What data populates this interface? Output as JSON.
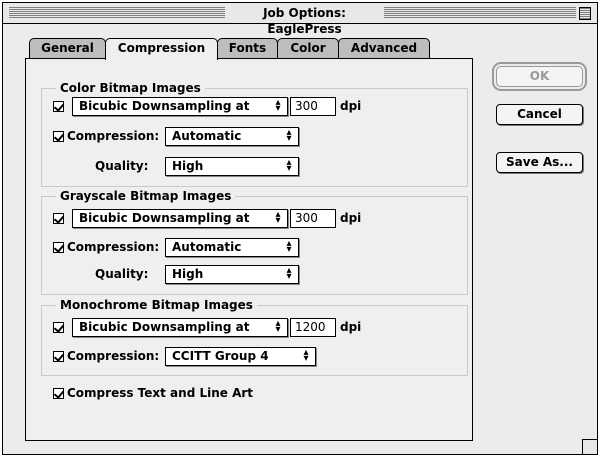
{
  "window": {
    "title": "Job Options: EaglePress"
  },
  "tabs": [
    {
      "label": "General",
      "active": false
    },
    {
      "label": "Compression",
      "active": true
    },
    {
      "label": "Fonts",
      "active": false
    },
    {
      "label": "Color",
      "active": false
    },
    {
      "label": "Advanced",
      "active": false
    }
  ],
  "color_bitmap": {
    "title": "Color Bitmap Images",
    "downsampling_checked": true,
    "downsampling_method": "Bicubic Downsampling at",
    "resolution": "300",
    "unit": "dpi",
    "compression_checked": true,
    "compression_label": "Compression:",
    "compression_value": "Automatic",
    "quality_label": "Quality:",
    "quality_value": "High"
  },
  "grayscale_bitmap": {
    "title": "Grayscale Bitmap Images",
    "downsampling_checked": true,
    "downsampling_method": "Bicubic Downsampling at",
    "resolution": "300",
    "unit": "dpi",
    "compression_checked": true,
    "compression_label": "Compression:",
    "compression_value": "Automatic",
    "quality_label": "Quality:",
    "quality_value": "High"
  },
  "monochrome_bitmap": {
    "title": "Monochrome Bitmap Images",
    "downsampling_checked": true,
    "downsampling_method": "Bicubic Downsampling at",
    "resolution": "1200",
    "unit": "dpi",
    "compression_checked": true,
    "compression_label": "Compression:",
    "compression_value": "CCITT Group 4"
  },
  "compress_text": {
    "checked": true,
    "label": "Compress Text and Line Art"
  },
  "buttons": {
    "ok": "OK",
    "cancel": "Cancel",
    "save_as": "Save As..."
  }
}
